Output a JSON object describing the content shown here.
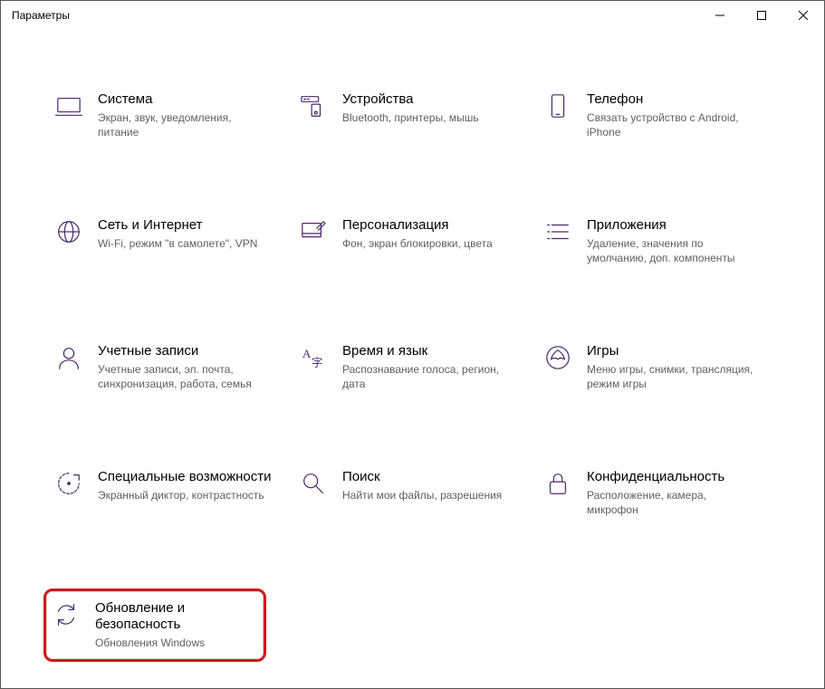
{
  "window": {
    "title": "Параметры"
  },
  "tiles": [
    {
      "title": "Система",
      "desc": "Экран, звук, уведомления, питание"
    },
    {
      "title": "Устройства",
      "desc": "Bluetooth, принтеры, мышь"
    },
    {
      "title": "Телефон",
      "desc": "Связать устройство с Android, iPhone"
    },
    {
      "title": "Сеть и Интернет",
      "desc": "Wi-Fi, режим \"в самолете\", VPN"
    },
    {
      "title": "Персонализация",
      "desc": "Фон, экран блокировки, цвета"
    },
    {
      "title": "Приложения",
      "desc": "Удаление, значения по умолчанию, доп. компоненты"
    },
    {
      "title": "Учетные записи",
      "desc": "Учетные записи, эл. почта, синхронизация, работа, семья"
    },
    {
      "title": "Время и язык",
      "desc": "Распознавание голоса, регион, дата"
    },
    {
      "title": "Игры",
      "desc": "Меню игры, снимки, трансляция, режим игры"
    },
    {
      "title": "Специальные возможности",
      "desc": "Экранный диктор, контрастность"
    },
    {
      "title": "Поиск",
      "desc": "Найти мои файлы, разрешения"
    },
    {
      "title": "Конфиденциальность",
      "desc": "Расположение, камера, микрофон"
    },
    {
      "title": "Обновление и безопасность",
      "desc": "Обновления Windows"
    }
  ]
}
